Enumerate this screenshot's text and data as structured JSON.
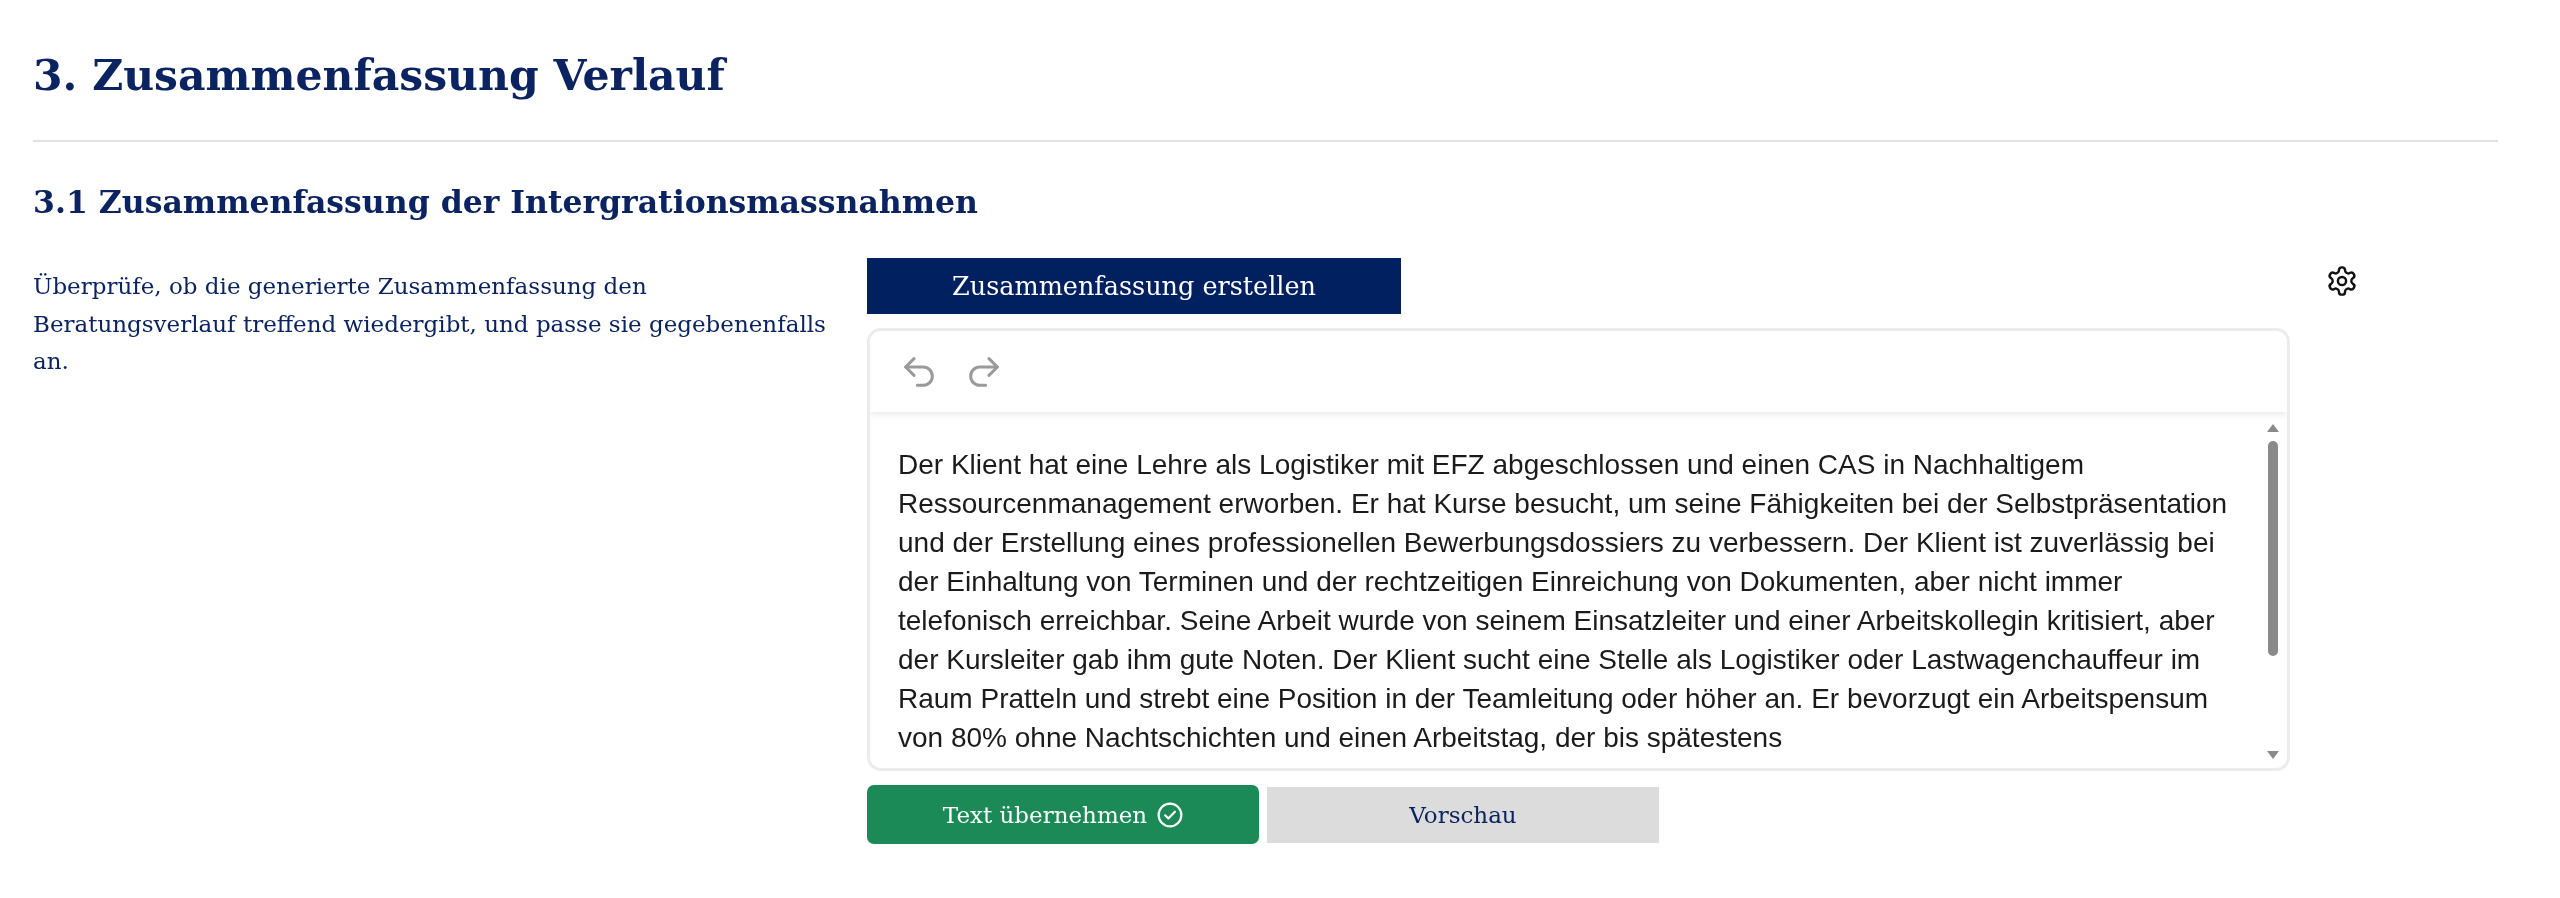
{
  "section": {
    "title": "3. Zusammenfassung Verlauf"
  },
  "subsection": {
    "title": "3.1 Zusammenfassung der Intergrationsmassnahmen"
  },
  "instructions": "Überprüfe, ob die generierte Zusammenfassung den Beratungsverlauf treffend wiedergibt, und passe sie gegebenenfalls an.",
  "generate_button": {
    "label": "Zusammenfassung erstellen"
  },
  "editor": {
    "text": "Der Klient hat eine Lehre als Logistiker mit EFZ abgeschlossen und einen CAS in Nachhaltigem Ressourcenmanagement erworben. Er hat Kurse besucht, um seine Fähigkeiten bei der Selbstpräsentation und der Erstellung eines professionellen Bewerbungsdossiers zu verbessern. Der Klient ist zuverlässig bei der Einhaltung von Terminen und der rechtzeitigen Einreichung von Dokumenten, aber nicht immer telefonisch erreichbar. Seine Arbeit wurde von seinem Einsatzleiter und einer Arbeitskollegin kritisiert, aber der Kursleiter gab ihm gute Noten. Der Klient sucht eine Stelle als Logistiker oder Lastwagenchauffeur im Raum Pratteln und strebt eine Position in der Teamleitung oder höher an. Er bevorzugt ein Arbeitspensum von 80% ohne Nachtschichten und einen Arbeitstag, der bis spätestens"
  },
  "actions": [
    {
      "label": "Text übernehmen",
      "kind": "primary"
    },
    {
      "label": "Vorschau",
      "kind": "secondary"
    }
  ]
}
